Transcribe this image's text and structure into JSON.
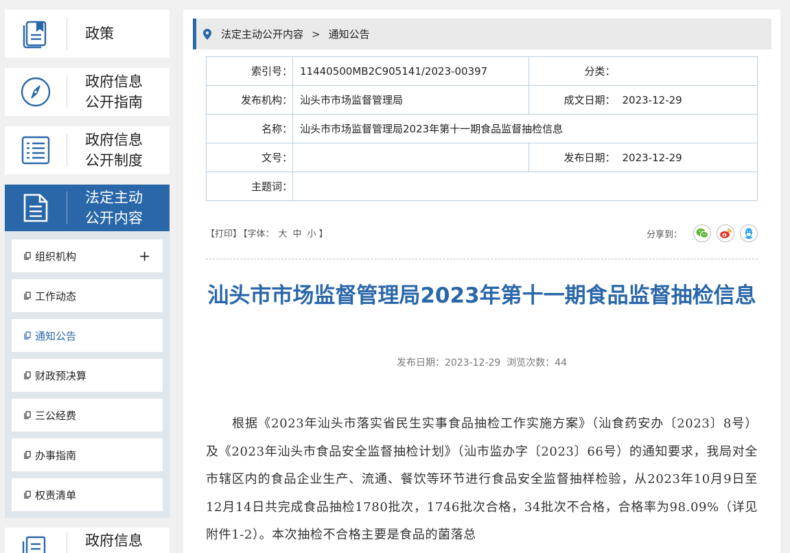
{
  "sidebar": {
    "cards": [
      {
        "label": "政策",
        "icon": "policy-book-icon"
      },
      {
        "label": "政府信息\n公开指南",
        "icon": "compass-icon"
      },
      {
        "label": "政府信息\n公开制度",
        "icon": "list-document-icon"
      },
      {
        "label": "法定主动\n公开内容",
        "icon": "document-icon"
      },
      {
        "label": "政府信息",
        "icon": "report-icon"
      }
    ],
    "submenu": [
      {
        "label": "组织机构",
        "expand": "+"
      },
      {
        "label": "工作动态"
      },
      {
        "label": "通知公告"
      },
      {
        "label": "财政预决算"
      },
      {
        "label": "三公经费"
      },
      {
        "label": "办事指南"
      },
      {
        "label": "权责清单"
      }
    ]
  },
  "breadcrumb": {
    "items": [
      "法定主动公开内容",
      "通知公告"
    ],
    "separator": ">"
  },
  "meta": {
    "index_label": "索引号：",
    "index_value": "11440500MB2C905141/2023-00397",
    "category_label": "分类：",
    "category_value": "",
    "publisher_label": "发布机构：",
    "publisher_value": "汕头市市场监督管理局",
    "created_label": "成文日期：",
    "created_value": "2023-12-29",
    "name_label": "名称：",
    "name_value": "汕头市市场监督管理局2023年第十一期食品监督抽检信息",
    "docno_label": "文号：",
    "docno_value": "",
    "published_label": "发布日期：",
    "published_value": "2023-12-29",
    "keywords_label": "主题词：",
    "keywords_value": ""
  },
  "toolbar": {
    "print": "【打印】",
    "font_prefix": "【字体：",
    "font_large": "大",
    "font_medium": "中",
    "font_small": "小",
    "font_suffix": "】",
    "share_label": "分享到：",
    "share_icons": [
      "wechat-icon",
      "weibo-icon",
      "qq-icon"
    ]
  },
  "article": {
    "title": "汕头市市场监督管理局2023年第十一期食品监督抽检信息",
    "pubinfo": "发布日期：2023-12-29  浏览次数：44",
    "body": "　　根据《2023年汕头市落实省民生实事食品抽检工作实施方案》（汕食药安办〔2023〕8号）及《2023年汕头市食品安全监督抽检计划》（汕市监办字〔2023〕66号）的通知要求，我局对全市辖区内的食品企业生产、流通、餐饮等环节进行食品安全监督抽样检验，从2023年10月9日至12月14日共完成食品抽检1780批次，1746批次合格，34批次不合格，合格率为98.09%（详见附件1-2）。本次抽检不合格主要是食品的菌落总"
  },
  "colors": {
    "brand_blue": "#2a67a9",
    "table_border": "#b9cfe1",
    "wechat": "#5cb531",
    "weibo": "#e6362c",
    "qq": "#1da1f2"
  }
}
